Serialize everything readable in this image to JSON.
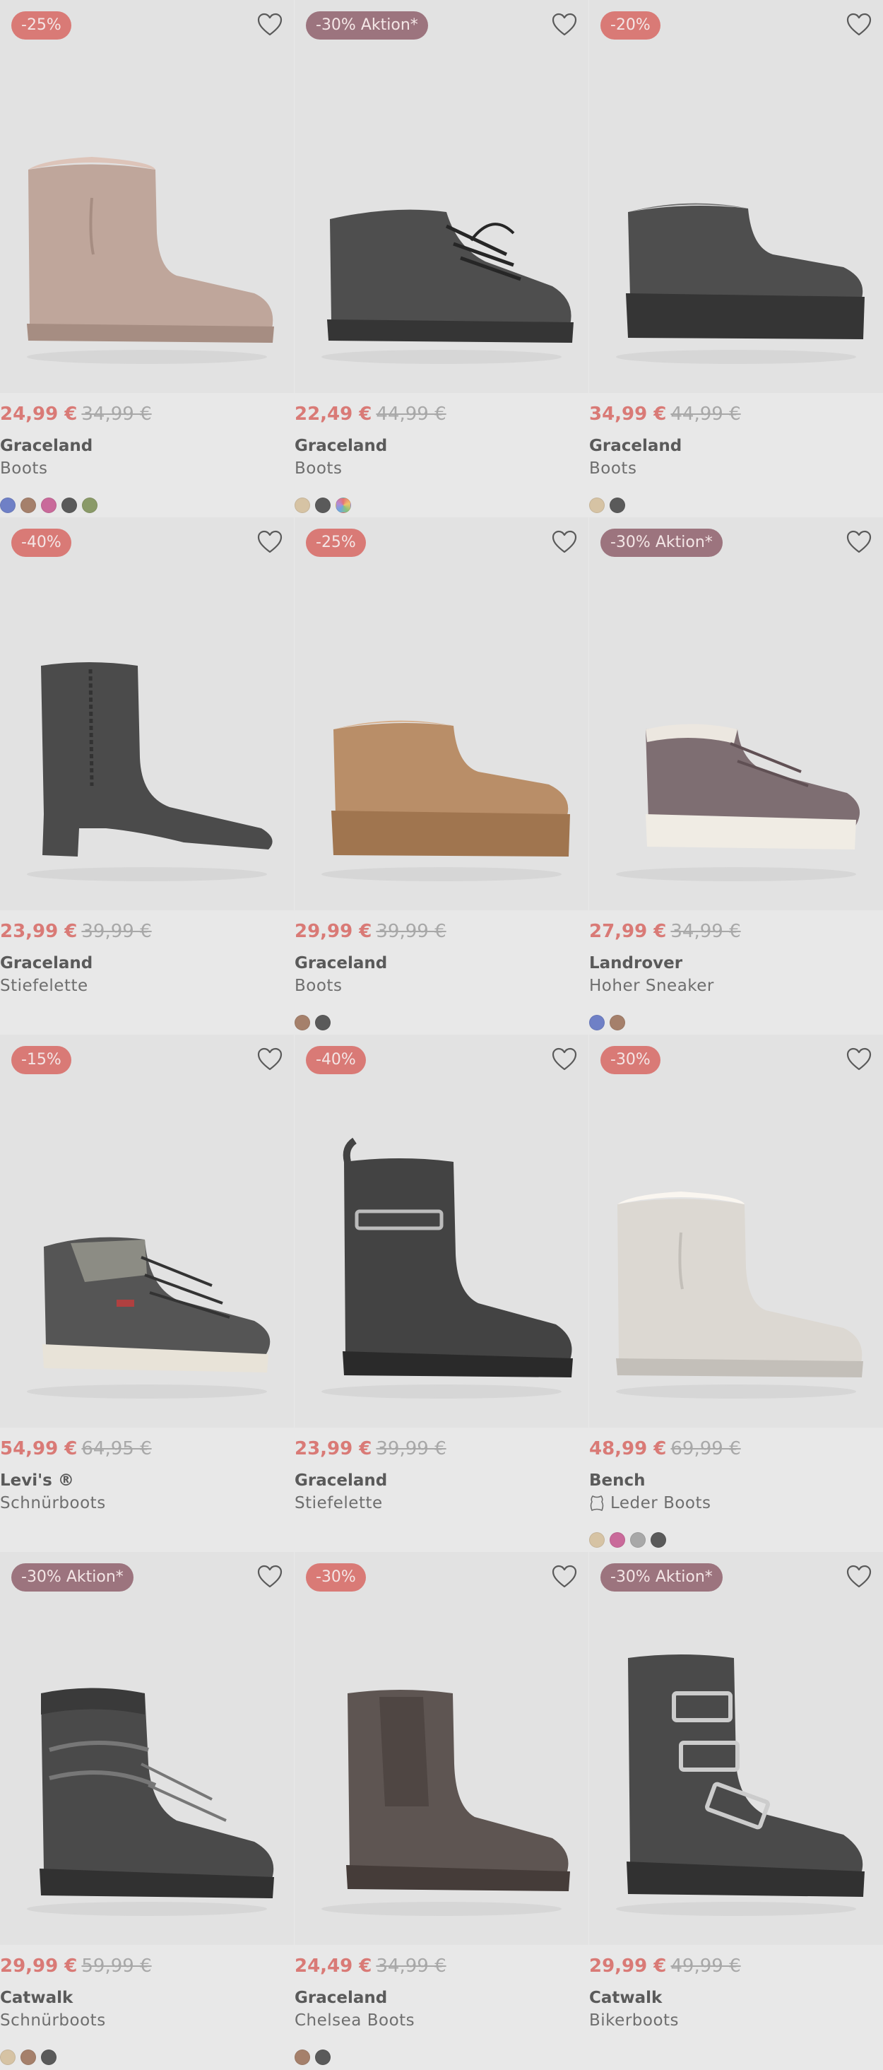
{
  "products": [
    {
      "badge": "-25%",
      "badge_type": "red",
      "price": "24,99 €",
      "old_price": "34,99 €",
      "brand": "Graceland",
      "type": "Boots",
      "shoe": {
        "kind": "mini-boot",
        "color": "#bfa69b"
      },
      "swatches": [
        "#6f80c6",
        "#a5806b",
        "#c96a9a",
        "#5a5a5a",
        "#8a9a68"
      ]
    },
    {
      "badge": "-30% Aktion*",
      "badge_type": "aktion",
      "price": "22,49 €",
      "old_price": "44,99 €",
      "brand": "Graceland",
      "type": "Boots",
      "shoe": {
        "kind": "lace-mini",
        "color": "#4e4e4e"
      },
      "swatches": [
        "#d6c3a4",
        "#5a5a5a",
        "multi"
      ]
    },
    {
      "badge": "-20%",
      "badge_type": "red",
      "price": "34,99 €",
      "old_price": "44,99 €",
      "brand": "Graceland",
      "type": "Boots",
      "shoe": {
        "kind": "platform-mini",
        "color": "#4e4e4e"
      },
      "swatches": [
        "#d6c3a4",
        "#5a5a5a"
      ]
    },
    {
      "badge": "-40%",
      "badge_type": "red",
      "price": "23,99 €",
      "old_price": "39,99 €",
      "brand": "Graceland",
      "type": "Stiefelette",
      "shoe": {
        "kind": "heel-ankle",
        "color": "#4b4b4b"
      },
      "swatches": []
    },
    {
      "badge": "-25%",
      "badge_type": "red",
      "price": "29,99 €",
      "old_price": "39,99 €",
      "brand": "Graceland",
      "type": "Boots",
      "shoe": {
        "kind": "platform-mini",
        "color": "#b98e68"
      },
      "swatches": [
        "#a5806b",
        "#5a5a5a"
      ]
    },
    {
      "badge": "-30% Aktion*",
      "badge_type": "aktion",
      "price": "27,99 €",
      "old_price": "34,99 €",
      "brand": "Landrover",
      "type": "Hoher Sneaker",
      "shoe": {
        "kind": "sneaker",
        "color": "#7e6e72"
      },
      "swatches": [
        "#6f80c6",
        "#a5806b"
      ]
    },
    {
      "badge": "-15%",
      "badge_type": "red",
      "price": "54,99 €",
      "old_price": "64,95 €",
      "brand": "Levi's ®",
      "type": "Schnürboots",
      "shoe": {
        "kind": "hiker",
        "color": "#555555"
      },
      "swatches": []
    },
    {
      "badge": "-40%",
      "badge_type": "red",
      "price": "23,99 €",
      "old_price": "39,99 €",
      "brand": "Graceland",
      "type": "Stiefelette",
      "shoe": {
        "kind": "chelsea-buckle",
        "color": "#434343"
      },
      "swatches": []
    },
    {
      "badge": "-30%",
      "badge_type": "red",
      "price": "48,99 €",
      "old_price": "69,99 €",
      "brand": "Bench",
      "type": "Leder Boots",
      "leather": true,
      "shoe": {
        "kind": "mini-boot",
        "color": "#dcd8d2"
      },
      "swatches": [
        "#d6c3a4",
        "#c96a9a",
        "#a8a8a8",
        "#5a5a5a"
      ]
    },
    {
      "badge": "-30% Aktion*",
      "badge_type": "aktion",
      "price": "29,99 €",
      "old_price": "59,99 €",
      "brand": "Catwalk",
      "type": "Schnürboots",
      "shoe": {
        "kind": "combat",
        "color": "#4a4a4a"
      },
      "swatches": [
        "#d6c3a4",
        "#a5806b",
        "#5a5a5a"
      ]
    },
    {
      "badge": "-30%",
      "badge_type": "red",
      "price": "24,49 €",
      "old_price": "34,99 €",
      "brand": "Graceland",
      "type": "Chelsea Boots",
      "shoe": {
        "kind": "chelsea",
        "color": "#5e5552"
      },
      "swatches": [
        "#a5806b",
        "#5a5a5a"
      ]
    },
    {
      "badge": "-30% Aktion*",
      "badge_type": "aktion",
      "price": "29,99 €",
      "old_price": "49,99 €",
      "brand": "Catwalk",
      "type": "Bikerboots",
      "shoe": {
        "kind": "biker",
        "color": "#4a4a4a"
      },
      "swatches": []
    }
  ],
  "icons": {
    "wishlist": "heart-outline-icon",
    "leather": "leather-hide-icon"
  }
}
